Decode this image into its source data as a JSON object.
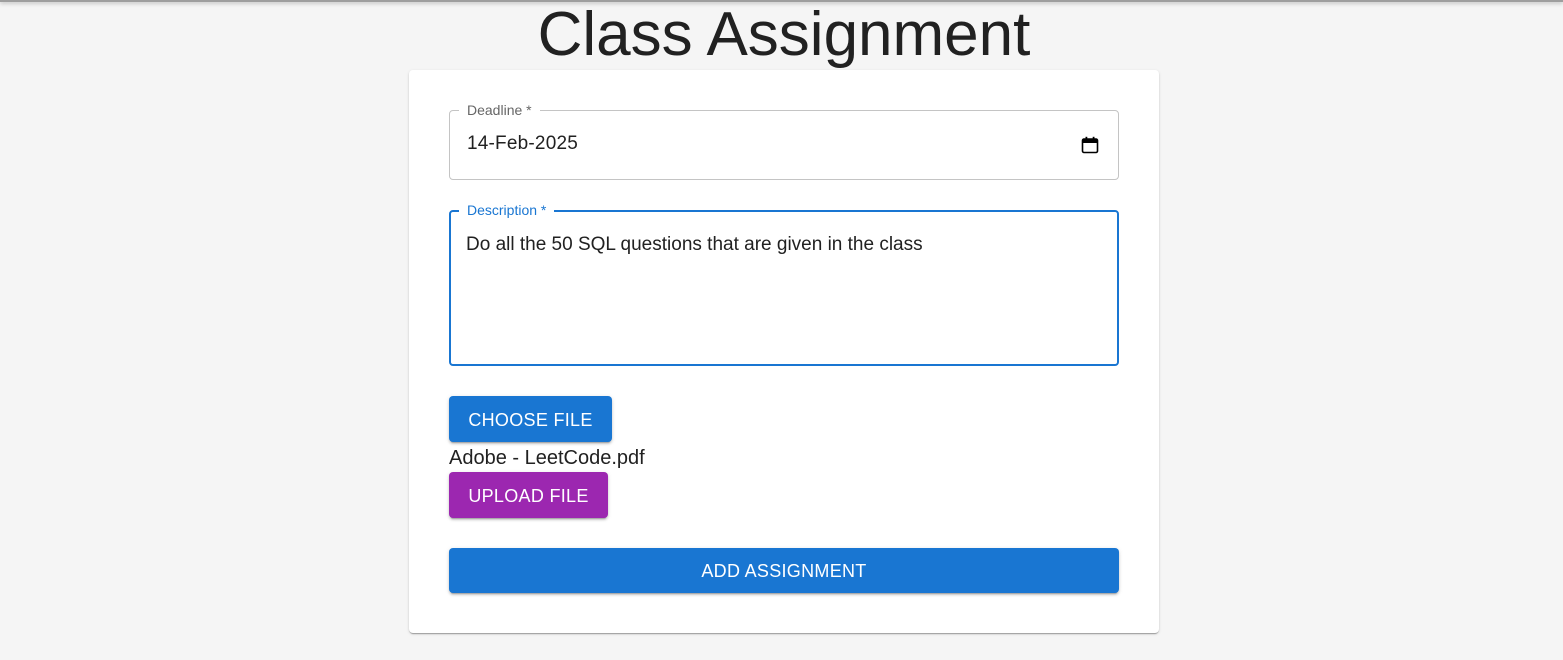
{
  "page": {
    "title": "Class Assignment"
  },
  "form": {
    "deadline": {
      "label": "Deadline *",
      "value": "14-Feb-2025",
      "icon": "calendar-icon"
    },
    "description": {
      "label": "Description *",
      "value": "Do all the 50 SQL questions that are given in the class"
    },
    "choose_file_label": "Choose File",
    "selected_file": "Adobe - LeetCode.pdf",
    "upload_file_label": "Upload File",
    "add_assignment_label": "Add Assignment"
  },
  "colors": {
    "primary": "#1976d2",
    "secondary": "#9c27b0",
    "background": "#f5f5f5",
    "card": "#ffffff"
  }
}
